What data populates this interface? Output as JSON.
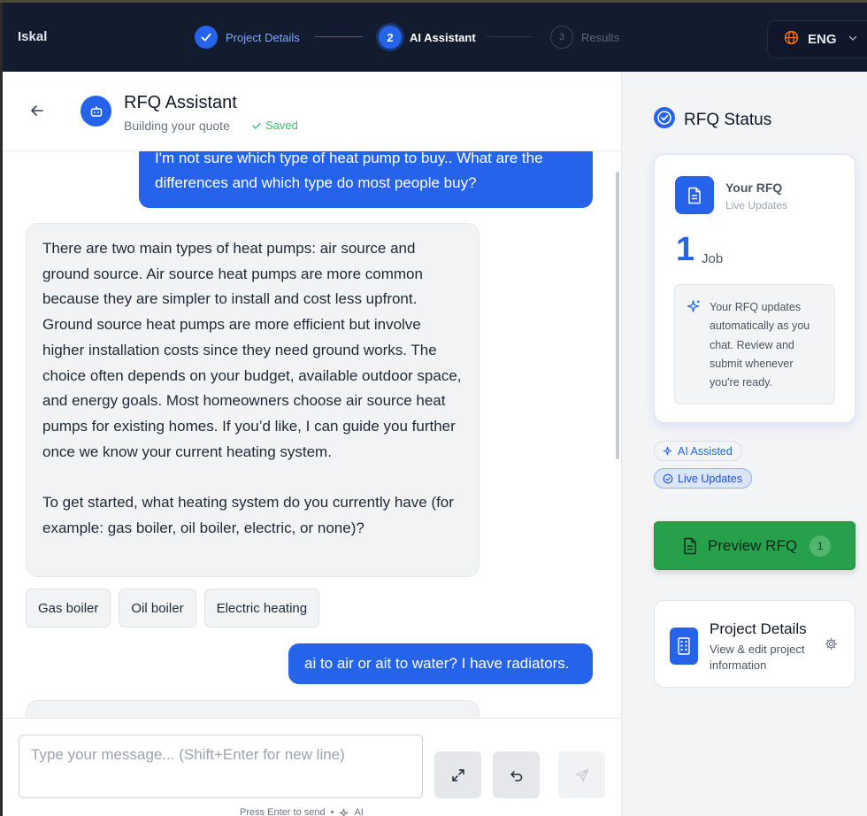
{
  "app": {
    "brand": "Iskal"
  },
  "steps": [
    {
      "label": "Project Details",
      "number": "1",
      "state": "done"
    },
    {
      "label": "AI Assistant",
      "number": "2",
      "state": "active"
    },
    {
      "label": "Results",
      "number": "3",
      "state": "pending"
    }
  ],
  "language": {
    "label": "ENG",
    "icon": "globe-icon"
  },
  "chat": {
    "title": "RFQ Assistant",
    "subtitle": "Building your quote",
    "saved_label": "Saved",
    "messages": [
      {
        "role": "user",
        "text": "I'm not sure which type of heat pump to buy.. What are the differences and which type do most people buy?"
      },
      {
        "role": "assistant",
        "paragraphs": [
          "There are two main types of heat pumps: air source and ground source. Air source heat pumps are more common because they are simpler to install and cost less upfront. Ground source heat pumps are more efficient but involve higher installation costs since they need ground works. The choice often depends on your budget, available outdoor space, and energy goals. Most homeowners choose air source heat pumps for existing homes. If you’d like, I can guide you further once we know your current heating system.",
          "To get started, what heating system do you currently have (for example: gas boiler, oil boiler, electric, or none)?"
        ]
      },
      {
        "role": "user",
        "text": "ai to air or ait to water? I have radiators."
      }
    ],
    "quick_replies": [
      "Gas boiler",
      "Oil boiler",
      "Electric heating"
    ],
    "input_placeholder": "Type your message... (Shift+Enter for new line)",
    "hint_text": "Press Enter to send",
    "hint_ai": "AI"
  },
  "sidebar": {
    "title": "RFQ Status",
    "rfq_card": {
      "name": "Your RFQ",
      "sub": "Live Updates",
      "count": "1",
      "count_unit": "Job",
      "note": "Your RFQ updates automatically as you chat. Review and submit whenever you're ready."
    },
    "badges": {
      "ai": "AI Assisted",
      "live": "Live Updates"
    },
    "preview": {
      "label": "Preview RFQ",
      "count": "1"
    },
    "project": {
      "name": "Project Details",
      "sub": "View & edit project information"
    }
  },
  "colors": {
    "accent": "#2563eb",
    "topbar": "#131b2e",
    "preview_green": "#27a04b",
    "saved_green": "#3fbf6a"
  }
}
